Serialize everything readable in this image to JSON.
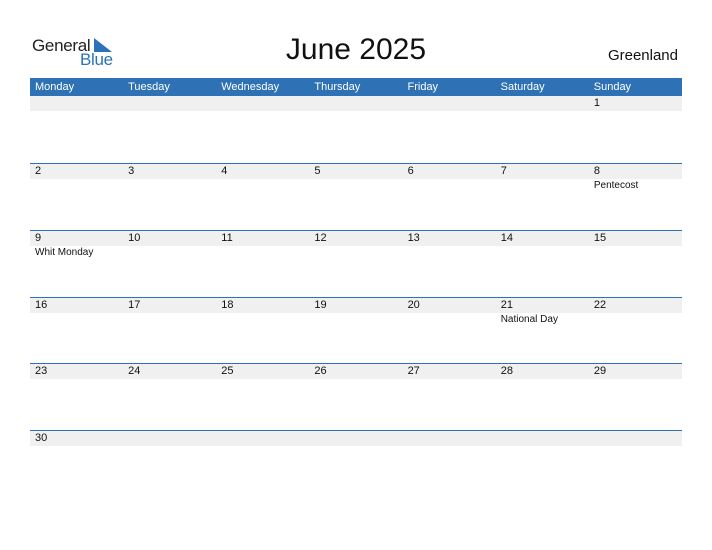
{
  "logo": {
    "word1": "General",
    "word2": "Blue",
    "icon": "triangle-flag-icon",
    "brand_color": "#2b72b8"
  },
  "title": "June 2025",
  "country": "Greenland",
  "colors": {
    "header": "#2e72b5",
    "band": "#f0f0f0"
  },
  "weekdays": [
    "Monday",
    "Tuesday",
    "Wednesday",
    "Thursday",
    "Friday",
    "Saturday",
    "Sunday"
  ],
  "weeks": [
    [
      {
        "day": ""
      },
      {
        "day": ""
      },
      {
        "day": ""
      },
      {
        "day": ""
      },
      {
        "day": ""
      },
      {
        "day": ""
      },
      {
        "day": "1"
      }
    ],
    [
      {
        "day": "2"
      },
      {
        "day": "3"
      },
      {
        "day": "4"
      },
      {
        "day": "5"
      },
      {
        "day": "6"
      },
      {
        "day": "7"
      },
      {
        "day": "8",
        "holiday": "Pentecost"
      }
    ],
    [
      {
        "day": "9",
        "holiday": "Whit Monday"
      },
      {
        "day": "10"
      },
      {
        "day": "11"
      },
      {
        "day": "12"
      },
      {
        "day": "13"
      },
      {
        "day": "14"
      },
      {
        "day": "15"
      }
    ],
    [
      {
        "day": "16"
      },
      {
        "day": "17"
      },
      {
        "day": "18"
      },
      {
        "day": "19"
      },
      {
        "day": "20"
      },
      {
        "day": "21",
        "holiday": "National Day"
      },
      {
        "day": "22"
      }
    ],
    [
      {
        "day": "23"
      },
      {
        "day": "24"
      },
      {
        "day": "25"
      },
      {
        "day": "26"
      },
      {
        "day": "27"
      },
      {
        "day": "28"
      },
      {
        "day": "29"
      }
    ],
    [
      {
        "day": "30"
      },
      {
        "day": ""
      },
      {
        "day": ""
      },
      {
        "day": ""
      },
      {
        "day": ""
      },
      {
        "day": ""
      },
      {
        "day": ""
      }
    ]
  ]
}
